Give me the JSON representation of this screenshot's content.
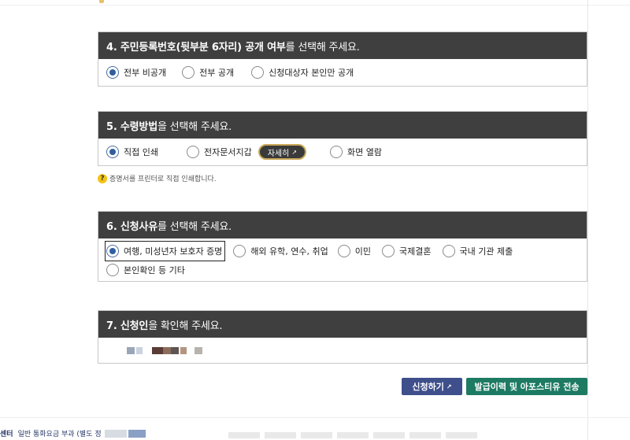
{
  "section4": {
    "title_bold": "4. 주민등록번호(뒷부분 6자리) 공개 여부",
    "title_rest": "를 선택해 주세요.",
    "options": [
      "전부 비공개",
      "전부 공개",
      "신청대상자 본인만 공개"
    ],
    "selected_index": 0
  },
  "section5": {
    "title_bold": "5. 수령방법",
    "title_rest": "을 선택해 주세요.",
    "options": [
      "직접 인쇄",
      "전자문서지갑",
      "화면 열람"
    ],
    "detail_button": "자세히",
    "selected_index": 0,
    "hint": "증명서를 프린터로 직접 인쇄합니다."
  },
  "section6": {
    "title_bold": "6. 신청사유",
    "title_rest": "를 선택해 주세요.",
    "options": [
      "여행, 미성년자 보호자 증명",
      "해외 유학, 연수, 취업",
      "이민",
      "국제결혼",
      "국내 기관 제출",
      "본인확인 등 기타"
    ],
    "selected_index": 0
  },
  "section7": {
    "title_bold": "7. 신청인",
    "title_rest": "을 확인해 주세요."
  },
  "buttons": {
    "apply": "신청하기",
    "history": "발급이력 및 아포스티유 전송"
  },
  "footer": {
    "center_label": "센터",
    "note": "일반 통화요금 부과 (별도 정"
  },
  "colors": {
    "header_bg": "#3f3f3f",
    "apply_btn": "#3e4f8c",
    "history_btn": "#1d7a63",
    "radio_checked": "#2f5f9e"
  }
}
